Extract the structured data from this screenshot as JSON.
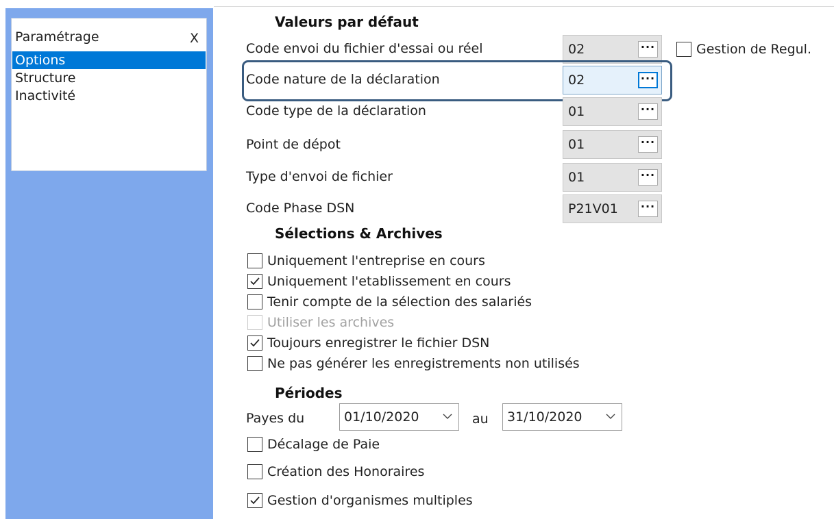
{
  "sidebar": {
    "title": "Paramétrage",
    "close": "X",
    "items": [
      {
        "label": "Options",
        "selected": true
      },
      {
        "label": "Structure",
        "selected": false
      },
      {
        "label": "Inactivité",
        "selected": false
      }
    ]
  },
  "defaults": {
    "title": "Valeurs par défaut",
    "fields": [
      {
        "label": "Code envoi du fichier d'essai ou réel",
        "value": "02",
        "button": "···"
      },
      {
        "label": "Code nature de la déclaration",
        "value": "02",
        "button": "···"
      },
      {
        "label": "Code type de la déclaration",
        "value": "01",
        "button": "···"
      },
      {
        "label": "Point de dépot",
        "value": "01",
        "button": "···"
      },
      {
        "label": "Type d'envoi de fichier",
        "value": "01",
        "button": "···"
      },
      {
        "label": "Code Phase DSN",
        "value": "P21V01",
        "button": "···"
      }
    ],
    "regul": {
      "label": "Gestion de Regul.",
      "checked": false
    }
  },
  "selections": {
    "title": "Sélections & Archives",
    "options": [
      {
        "label": "Uniquement l'entreprise en cours",
        "checked": false,
        "enabled": true
      },
      {
        "label": "Uniquement l'etablissement en cours",
        "checked": true,
        "enabled": true
      },
      {
        "label": "Tenir compte de la sélection des salariés",
        "checked": false,
        "enabled": true
      },
      {
        "label": "Utiliser les archives",
        "checked": false,
        "enabled": false
      },
      {
        "label": "Toujours enregistrer le fichier DSN",
        "checked": true,
        "enabled": true
      },
      {
        "label": "Ne pas générer les enregistrements non utilisés",
        "checked": false,
        "enabled": true
      }
    ]
  },
  "periods": {
    "title": "Périodes",
    "from_label": "Payes du",
    "from_value": "01/10/2020",
    "to_label": "au",
    "to_value": "31/10/2020",
    "options": [
      {
        "label": "Décalage de Paie",
        "checked": false
      },
      {
        "label": "Création des Honoraires",
        "checked": false
      },
      {
        "label": "Gestion d'organismes multiples",
        "checked": true
      }
    ]
  },
  "colors": {
    "sidebar_bg": "#7ea8ec",
    "selection": "#0078d7",
    "highlight_border": "#3a5c80"
  }
}
